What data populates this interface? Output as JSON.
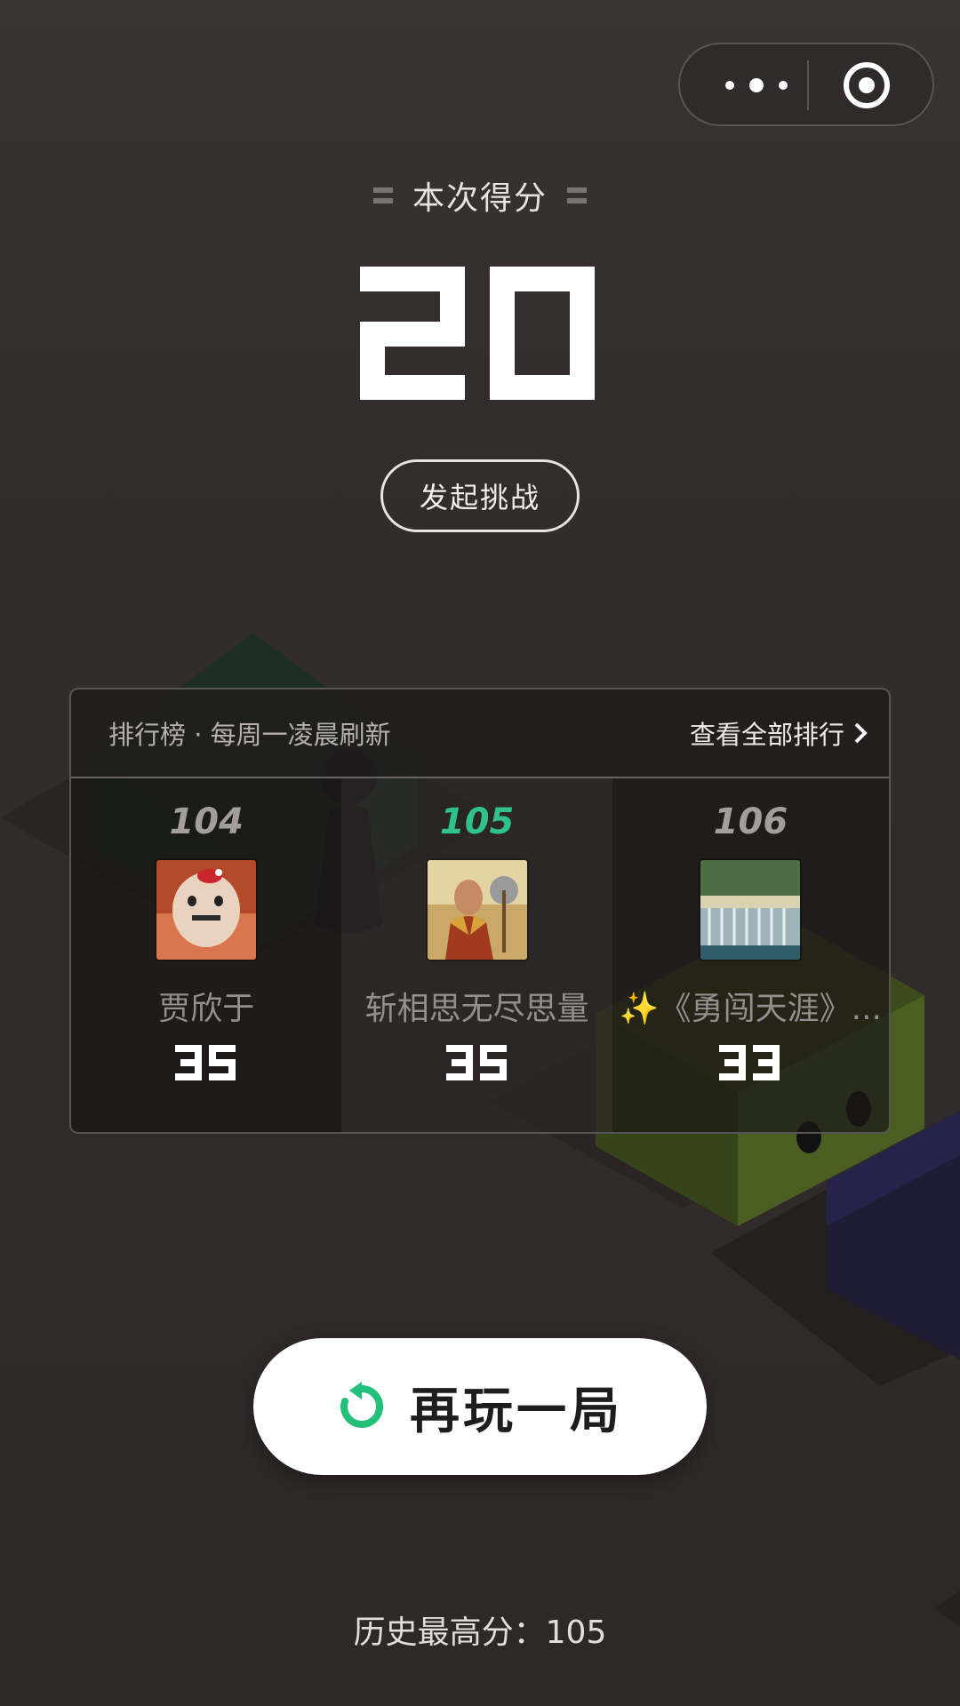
{
  "capsule": {
    "more_icon": "more-dots-icon",
    "close_icon": "target-circle-icon"
  },
  "score": {
    "label": "本次得分",
    "value": "20"
  },
  "challenge": {
    "label": "发起挑战"
  },
  "leaderboard": {
    "title": "排行榜 · 每周一凌晨刷新",
    "view_all": "查看全部排行",
    "entries": [
      {
        "rank": "104",
        "name": "贾欣于",
        "score": "35",
        "avatar": "hamster-photo"
      },
      {
        "rank": "105",
        "name": "斩相思无尽思量",
        "score": "35",
        "avatar": "warrior-photo"
      },
      {
        "rank": "106",
        "name": "✨《勇闯天涯》...",
        "score": "33",
        "avatar": "waterfall-photo"
      }
    ]
  },
  "replay": {
    "label": "再玩一局"
  },
  "best": {
    "text": "历史最高分：105"
  },
  "colors": {
    "accent": "#2fc28c",
    "background": "#312a2a",
    "button": "#ffffff"
  }
}
